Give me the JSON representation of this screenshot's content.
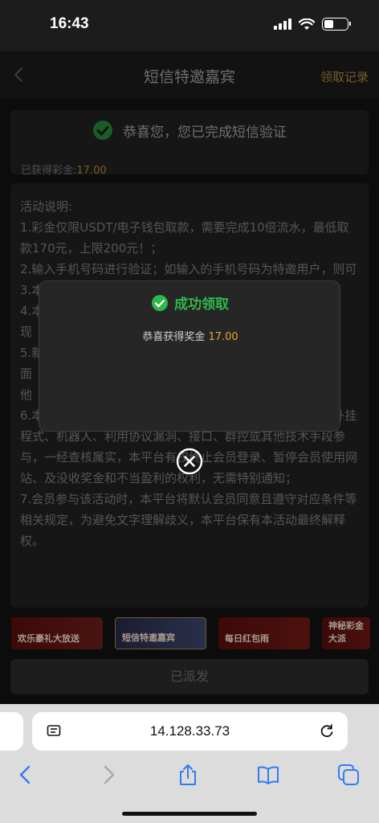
{
  "status_bar": {
    "time": "16:43"
  },
  "header": {
    "title": "短信特邀嘉宾",
    "records_link": "领取记录"
  },
  "verify": {
    "message": "恭喜您，您已完成短信验证",
    "bonus_label": "已获得彩金:",
    "bonus_amount": "17.00"
  },
  "rules": {
    "title": "活动说明:",
    "items": [
      "1.彩金仅限USDT/电子钱包取款，需要完成10倍流水，最低取款170元，上限200元！；",
      "2.输入手机号码进行验证；如输入的手机号码为特邀用户，则可",
      "3.本",
      "4.本",
      "现",
      "5.新",
      "面",
      "他",
      "6.本活动仅限账号本人领取奖励，禁止租借账号，不得使用外挂程式、机器人、利用协议漏洞、接口、群控或其他技术手段参与，一经查核属实，本平台有权终止会员登录、暂停会员使用网站、及没收奖金和不当盈利的权利，无需特别通知；",
      "7.会员参与该活动时，本平台将默认会员同意且遵守对应条件等相关规定，为避免文字理解歧义，本平台保有本活动最终解释权。"
    ]
  },
  "banners": [
    {
      "label": "欢乐豪礼大放送"
    },
    {
      "label": "短信特邀嘉宾"
    },
    {
      "label": "每日红包雨"
    },
    {
      "label": "神秘彩金大派"
    }
  ],
  "dispatched_button": "已派发",
  "browser": {
    "url": "14.128.33.73"
  },
  "modal": {
    "title": "成功领取",
    "message_label": "恭喜获得奖金",
    "amount": "17.00"
  },
  "colors": {
    "success": "#2db84a",
    "gold": "#e6a532",
    "muted_gold": "#7a5c24"
  }
}
